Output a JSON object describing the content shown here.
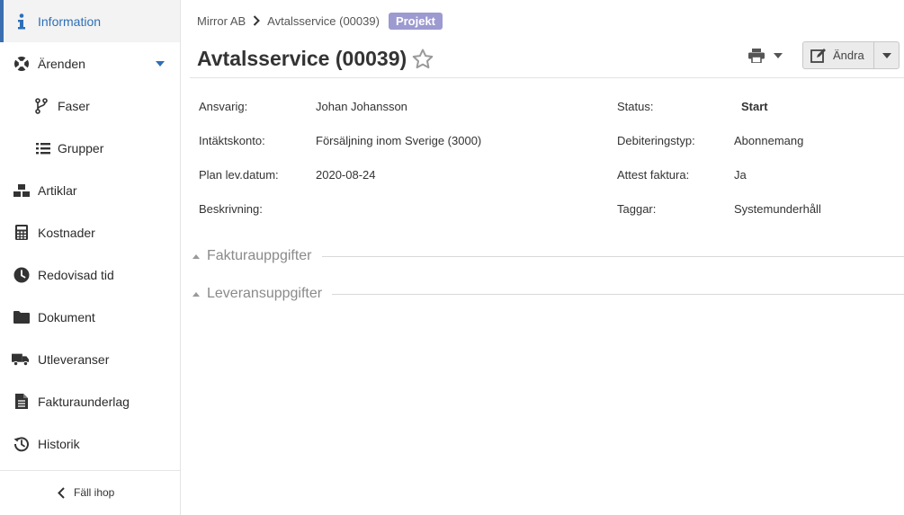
{
  "sidebar": {
    "items": [
      {
        "label": "Information",
        "icon": "info-icon"
      },
      {
        "label": "Ärenden",
        "icon": "lifebuoy-icon"
      },
      {
        "label": "Faser",
        "icon": "branch-icon"
      },
      {
        "label": "Grupper",
        "icon": "list-icon"
      },
      {
        "label": "Artiklar",
        "icon": "boxes-icon"
      },
      {
        "label": "Kostnader",
        "icon": "calculator-icon"
      },
      {
        "label": "Redovisad tid",
        "icon": "clock-icon"
      },
      {
        "label": "Dokument",
        "icon": "folder-icon"
      },
      {
        "label": "Utleveranser",
        "icon": "truck-icon"
      },
      {
        "label": "Fakturaunderlag",
        "icon": "document-icon"
      },
      {
        "label": "Historik",
        "icon": "history-icon"
      }
    ],
    "collapse_label": "Fäll ihop"
  },
  "breadcrumb": {
    "company": "Mirror AB",
    "current": "Avtalsservice (00039)",
    "badge": "Projekt"
  },
  "page": {
    "title": "Avtalsservice (00039)",
    "edit_label": "Ändra"
  },
  "fields": {
    "ansvarig": {
      "label": "Ansvarig:",
      "value": "Johan Johansson"
    },
    "intaktskonto": {
      "label": "Intäktskonto:",
      "value": "Försäljning inom Sverige (3000)"
    },
    "plan": {
      "label": "Plan lev.datum:",
      "value": "2020-08-24"
    },
    "beskrivning": {
      "label": "Beskrivning:",
      "value": ""
    },
    "status": {
      "label": "Status:",
      "value": "Start"
    },
    "debiteringstyp": {
      "label": "Debiteringstyp:",
      "value": "Abonnemang"
    },
    "attest": {
      "label": "Attest faktura:",
      "value": "Ja"
    },
    "taggar": {
      "label": "Taggar:",
      "value": "Systemunderhåll"
    }
  },
  "sections": {
    "faktura": "Fakturauppgifter",
    "leverans": "Leveransuppgifter"
  },
  "colors": {
    "accent": "#2d6fb7",
    "badge": "#9c9ad0"
  }
}
